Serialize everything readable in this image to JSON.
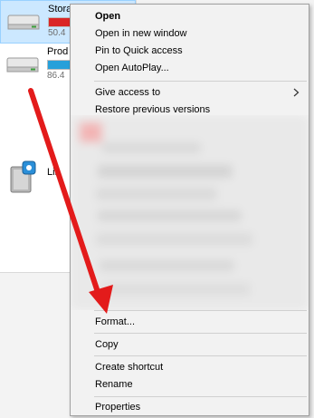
{
  "explorer": {
    "drives": [
      {
        "name": "Stora",
        "space": "50.4",
        "fill": 0.85,
        "bar_color": "#da2626",
        "selected": true
      },
      {
        "name": "Prod",
        "space": "86.4",
        "fill": 0.6,
        "bar_color": "#26a0da",
        "selected": false
      }
    ],
    "devices": [
      {
        "name": "Lin"
      }
    ]
  },
  "context_menu": {
    "items": [
      {
        "label": "Open",
        "bold": true
      },
      {
        "label": "Open in new window"
      },
      {
        "label": "Pin to Quick access"
      },
      {
        "label": "Open AutoPlay..."
      },
      {
        "label": "Give access to",
        "submenu": true
      },
      {
        "label": "Restore previous versions"
      },
      {
        "label": "Format..."
      },
      {
        "label": "Copy"
      },
      {
        "label": "Create shortcut"
      },
      {
        "label": "Rename"
      },
      {
        "label": "Properties"
      }
    ]
  },
  "colors": {
    "annotation_arrow": "#e31b1b",
    "selection_bg": "#cce8ff"
  }
}
